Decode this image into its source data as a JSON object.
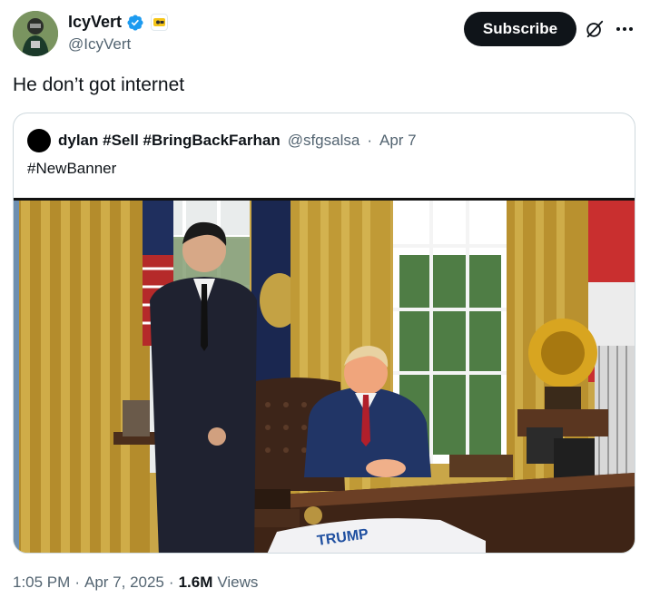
{
  "author": {
    "display_name": "IcyVert",
    "handle": "@IcyVert",
    "verified": true,
    "avatar_icon": "avatar-football-player"
  },
  "actions": {
    "subscribe_label": "Subscribe",
    "grok_icon": "grok-icon",
    "more_icon": "more-icon"
  },
  "tweet": {
    "text": "He don’t got internet"
  },
  "quoted": {
    "display_name": "dylan #Sell #BringBackFarhan",
    "handle": "@sfgsalsa",
    "separator": "·",
    "date": "Apr 7",
    "text": "#NewBanner",
    "jersey_text": "TRUMP"
  },
  "meta": {
    "time": "1:05 PM",
    "sep1": "·",
    "date": "Apr 7, 2025",
    "sep2": "·",
    "views_count": "1.6M",
    "views_label": "Views"
  },
  "colors": {
    "accent_verified": "#1d9bf0",
    "text_primary": "#0f1419",
    "text_secondary": "#536471",
    "border": "#cfd9de"
  }
}
